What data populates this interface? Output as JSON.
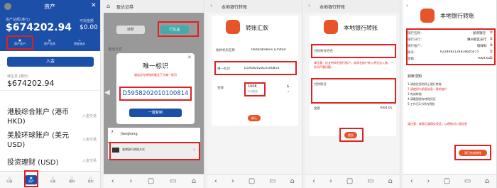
{
  "p1": {
    "header_title": "资产",
    "total_label": "资产总额(港元)",
    "total_value": "$674202.94",
    "cash_label": "可现金额",
    "cash_value": "$0.00",
    "act1": "资产总户",
    "act2": "资产总览",
    "act3": "资金流水",
    "deposit_btn": "入金",
    "sec_label": "待生息 (港元)",
    "sec_value": "$674202.94",
    "rows": [
      {
        "name": "港股综合账户 (港币HKD)",
        "action": "入金交易"
      },
      {
        "name": "美股环球账户 (美元USD)",
        "action": "入金交易"
      },
      {
        "name": "投资理财 (USD)",
        "action": "入金交易"
      }
    ],
    "tabs": [
      "行情",
      "资产",
      "交易",
      "理财",
      "我的"
    ]
  },
  "p2": {
    "url": "盈达证券",
    "btn_left": "转账",
    "btn_right": "行生益",
    "modal_title": "唯一标识",
    "modal_hint": "请务必在转账时备注下方唯一标识",
    "modal_id": "D5958202010100814",
    "copy_btn": "一键复制",
    "list_label": "其他方式",
    "bank_label": "香港银行转账方式",
    "item_text": "Jiangtong"
  },
  "p3": {
    "url": "本地银行转账",
    "title": "转账汇款",
    "bank_row_label": "收款机构名称",
    "bank_row_value": "RadarBrokers Limited",
    "id_label": "唯一标识",
    "id_value": "D5958202010100814",
    "amount_label": "金额",
    "amount_value": "100K",
    "amount_sub": "可用额度",
    "currency": "$",
    "confirm_btn": "确认"
  },
  "p4": {
    "url": "本地银行转账",
    "title": "本地银行转账",
    "field1": "付款账号姓名",
    "warn": "请注意：仅支持同名银行账户，非同名账户转入将无法入账，一系列严重问题。",
    "field2": "付款账号",
    "amount_label": "金额",
    "amount_value": "7004.65",
    "submit_btn": "提交"
  },
  "p5": {
    "title": "本地银行转账",
    "rows": [
      {
        "label": "银行名称：",
        "value": "浙商银行"
      },
      {
        "label": "银行分行：",
        "value": "惠州新区支行"
      },
      {
        "label": "银行账户：",
        "value": "瑞祥科"
      },
      {
        "label": "账号：",
        "value": "6228481134838645475"
      },
      {
        "label": "金额：",
        "value": "7004.65"
      }
    ],
    "notes_title": "转账须知",
    "notes": [
      "1.请前往您的网上银行转账",
      "2.请使用与前面信息一致的账户",
      "3.完成转账",
      "4.请截图保存转账凭证",
      "5.工作日2小时内到账"
    ],
    "warn": "请注意：收款后请保存凭证，以便核对入账信息",
    "done_btn": "我已完成转账"
  },
  "browser_icons": [
    "‹",
    "›",
    "▢",
    "▭",
    "⌂"
  ]
}
